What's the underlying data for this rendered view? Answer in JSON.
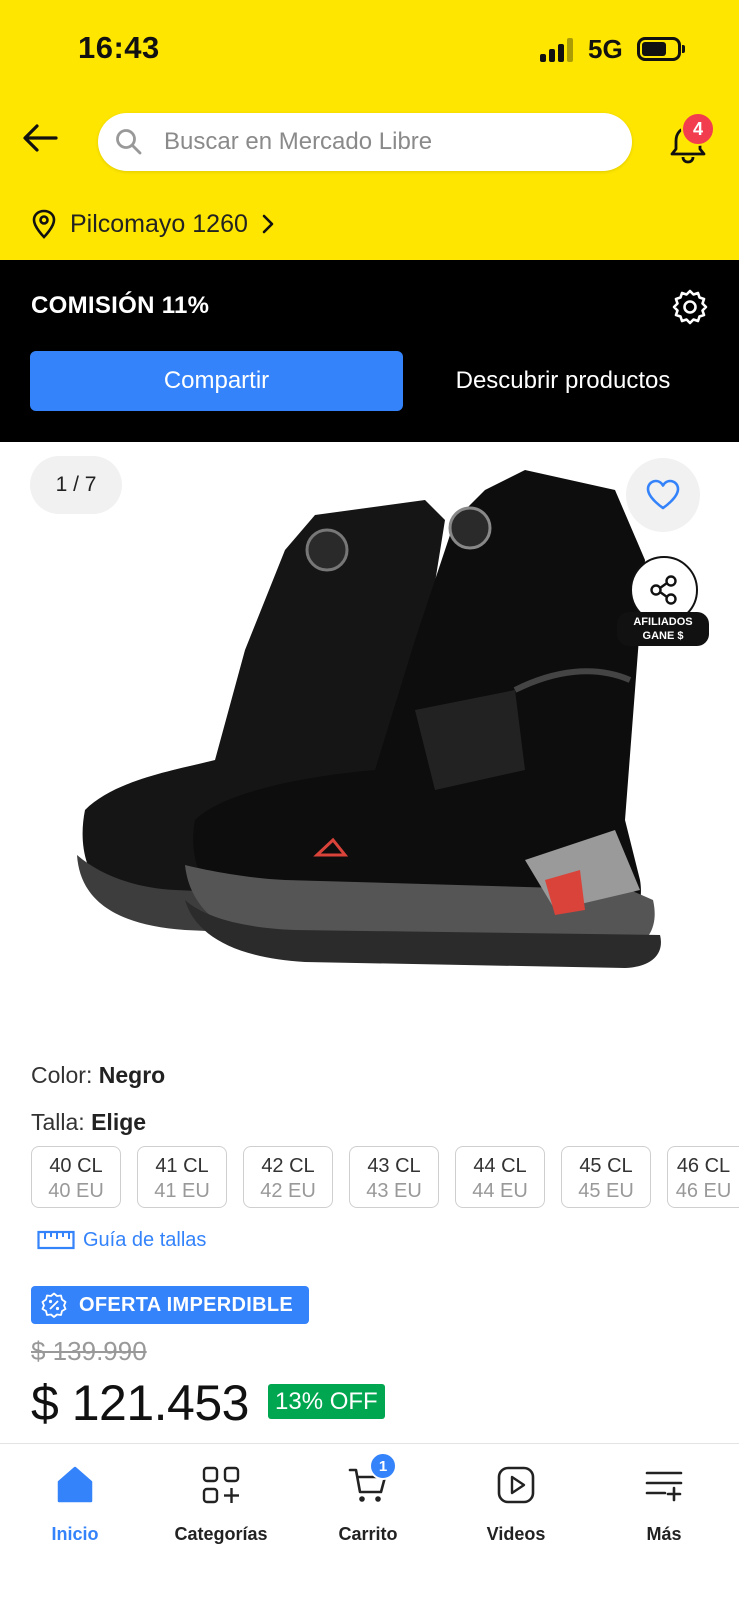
{
  "status_bar": {
    "time": "16:43",
    "network": "5G"
  },
  "header": {
    "search_placeholder": "Buscar en Mercado Libre",
    "notifications_count": "4",
    "location": "Pilcomayo 1260"
  },
  "affiliate": {
    "commission": "COMISIÓN 11%",
    "share_label": "Compartir",
    "discover_label": "Descubrir productos",
    "badge_line1": "AFILIADOS",
    "badge_line2": "GANE $"
  },
  "gallery": {
    "counter": "1 / 7"
  },
  "product": {
    "color_label": "Color:",
    "color_value": "Negro",
    "size_label": "Talla:",
    "size_value": "Elige",
    "sizes": [
      {
        "cl": "40 CL",
        "eu": "40 EU"
      },
      {
        "cl": "41 CL",
        "eu": "41 EU"
      },
      {
        "cl": "42 CL",
        "eu": "42 EU"
      },
      {
        "cl": "43 CL",
        "eu": "43 EU"
      },
      {
        "cl": "44 CL",
        "eu": "44 EU"
      },
      {
        "cl": "45 CL",
        "eu": "45 EU"
      },
      {
        "cl": "46 CL",
        "eu": "46 EU"
      }
    ],
    "size_guide": "Guía de tallas",
    "deal_label": "OFERTA IMPERDIBLE",
    "old_price": "$ 139.990",
    "price": "$ 121.453",
    "discount": "13% OFF"
  },
  "bottom_nav": {
    "items": [
      {
        "label": "Inicio",
        "icon": "home-icon"
      },
      {
        "label": "Categorías",
        "icon": "categories-icon"
      },
      {
        "label": "Carrito",
        "icon": "cart-icon"
      },
      {
        "label": "Videos",
        "icon": "video-icon"
      },
      {
        "label": "Más",
        "icon": "menu-icon"
      }
    ],
    "cart_count": "1"
  },
  "colors": {
    "header_bg": "#fee600",
    "accent": "#3483fa",
    "discount_green": "#00a650",
    "badge_red": "#f23d4f"
  }
}
